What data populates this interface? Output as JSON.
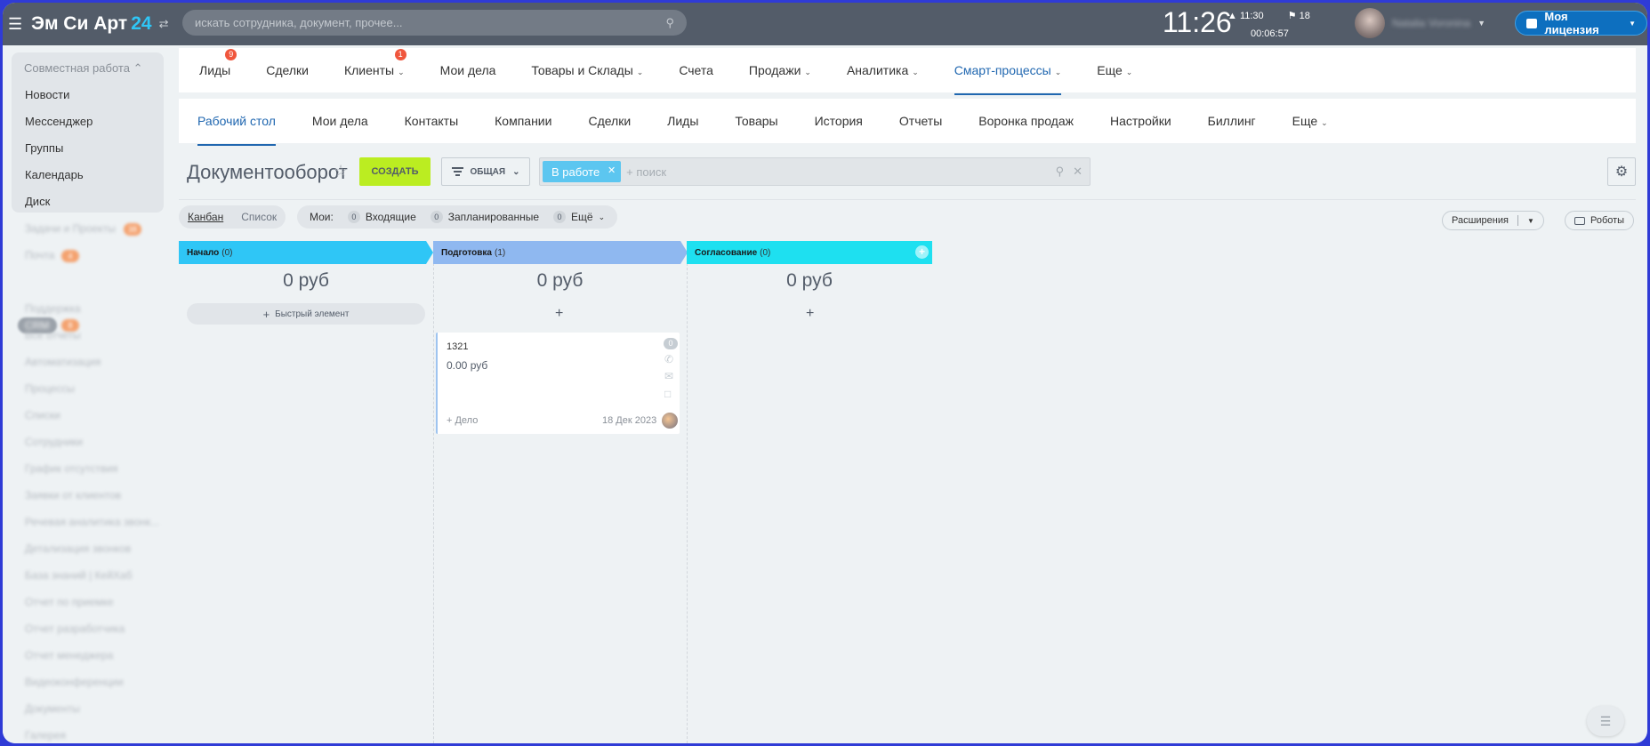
{
  "topbar": {
    "logo_main": "Эм Си Арт",
    "logo_num": "24",
    "search_placeholder": "искать сотрудника, документ, прочее...",
    "clock": "11:26",
    "alarm": "11:30",
    "flag_count": "18",
    "timer": "00:06:57",
    "user_name": "Natalia Voronina",
    "license": "Моя лицензия"
  },
  "sidebar": {
    "group_title": "Совместная работа",
    "items": [
      "Новости",
      "Мессенджер",
      "Группы",
      "Календарь",
      "Диск"
    ],
    "faded_items": [
      "Задачи и Проекты",
      "Почта",
      "CRM",
      "Поддержка",
      "Все отчеты",
      "Автоматизация",
      "Процессы",
      "Списки",
      "Сотрудники",
      "График отсутствия",
      "Заявки от клиентов",
      "Речевая аналитика звонк...",
      "Детализация звонков",
      "База знаний | КейХаб",
      "Отчет по приемке",
      "Отчет разработчика",
      "Отчет менеджера",
      "Видеоконференции",
      "Документы",
      "Галерея"
    ],
    "badges": [
      "38",
      "4",
      "8"
    ]
  },
  "nav1": [
    {
      "label": "Лиды",
      "count": "9"
    },
    {
      "label": "Сделки"
    },
    {
      "label": "Клиенты",
      "count": "1",
      "dropdown": true
    },
    {
      "label": "Мои дела"
    },
    {
      "label": "Товары и Склады",
      "dropdown": true
    },
    {
      "label": "Счета"
    },
    {
      "label": "Продажи",
      "dropdown": true
    },
    {
      "label": "Аналитика",
      "dropdown": true
    },
    {
      "label": "Смарт-процессы",
      "dropdown": true,
      "active": true
    },
    {
      "label": "Еще",
      "dropdown": true
    }
  ],
  "nav2": [
    {
      "label": "Рабочий стол",
      "active": true
    },
    {
      "label": "Мои дела"
    },
    {
      "label": "Контакты"
    },
    {
      "label": "Компании"
    },
    {
      "label": "Сделки"
    },
    {
      "label": "Лиды"
    },
    {
      "label": "Товары"
    },
    {
      "label": "История"
    },
    {
      "label": "Отчеты"
    },
    {
      "label": "Воронка продаж"
    },
    {
      "label": "Настройки"
    },
    {
      "label": "Биллинг"
    },
    {
      "label": "Еще",
      "dropdown": true
    }
  ],
  "toolbar": {
    "title": "Документооборот",
    "create": "СОЗДАТЬ",
    "filter": "ОБЩАЯ",
    "chip": "В работе",
    "search_placeholder": "+ поиск"
  },
  "view": {
    "kanban": "Канбан",
    "list": "Список",
    "mine": "Мои:",
    "incoming_count": "0",
    "incoming": "Входящие",
    "planned_count": "0",
    "planned": "Запланированные",
    "more_count": "0",
    "more": "Ещё",
    "extensions": "Расширения",
    "robots": "Роботы"
  },
  "colors": {
    "stage1": "#2fc6f6",
    "stage2": "#8fb8f0",
    "stage3": "#1ee0f0",
    "create_btn": "#bbed21",
    "active_nav": "#2067b0"
  },
  "stages": [
    {
      "name": "Начало",
      "count": "(0)",
      "sum": "0 руб",
      "quick": "Быстрый элемент"
    },
    {
      "name": "Подготовка",
      "count": "(1)",
      "sum": "0 руб"
    },
    {
      "name": "Согласование",
      "count": "(0)",
      "sum": "0 руб"
    }
  ],
  "card": {
    "title": "1321",
    "price": "0.00 руб",
    "badge": "0",
    "action": "+ Дело",
    "date": "18 Дек 2023"
  }
}
